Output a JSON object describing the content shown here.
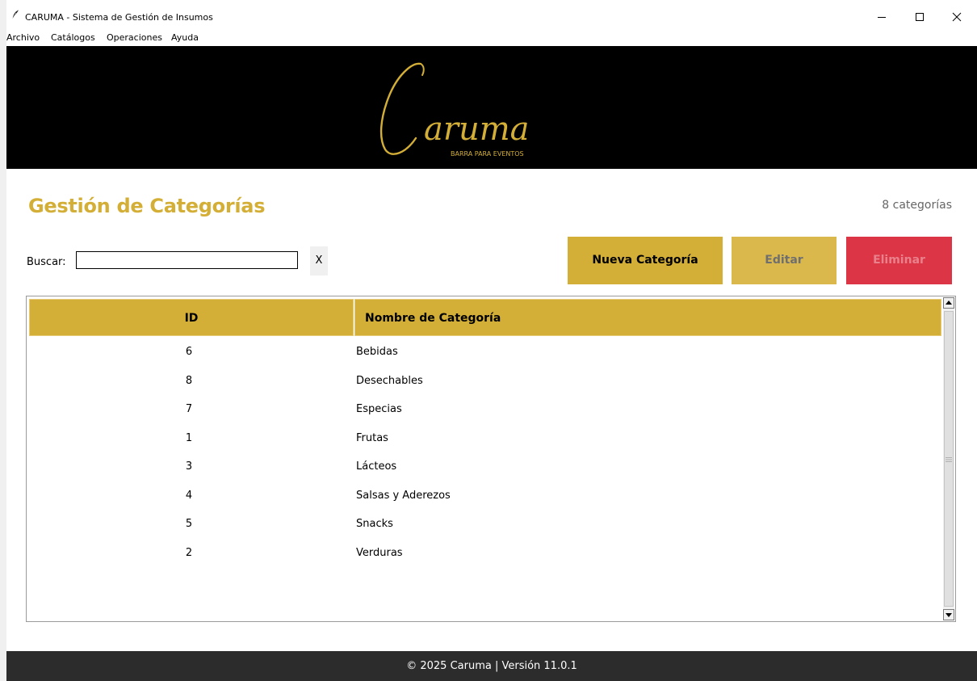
{
  "window": {
    "title": "CARUMA - Sistema de Gestión de Insumos"
  },
  "menu": {
    "items": [
      "Archivo",
      "Catálogos",
      "Operaciones",
      "Ayuda"
    ]
  },
  "banner": {
    "logo_text": "aruma",
    "logo_initial": "C",
    "tagline": "BARRA PARA EVENTOS",
    "background_color": "#000000",
    "logo_color": "#d4af37"
  },
  "page": {
    "title": "Gestión de Categorías",
    "count_label": "8 categorías"
  },
  "search": {
    "label": "Buscar:",
    "value": "",
    "clear_label": "X"
  },
  "actions": {
    "new_label": "Nueva Categoría",
    "edit_label": "Editar",
    "delete_label": "Eliminar"
  },
  "table": {
    "columns": [
      "ID",
      "Nombre de Categoría"
    ],
    "rows": [
      {
        "id": "6",
        "name": "Bebidas"
      },
      {
        "id": "8",
        "name": "Desechables"
      },
      {
        "id": "7",
        "name": "Especias"
      },
      {
        "id": "1",
        "name": "Frutas"
      },
      {
        "id": "3",
        "name": "Lácteos"
      },
      {
        "id": "4",
        "name": "Salsas y Aderezos"
      },
      {
        "id": "5",
        "name": "Snacks"
      },
      {
        "id": "2",
        "name": "Verduras"
      }
    ]
  },
  "footer": {
    "text": "© 2025 Caruma | Versión 11.0.1"
  },
  "colors": {
    "accent": "#d4af37",
    "danger": "#dc3545",
    "footer_bg": "#2c2c2c"
  },
  "icons": {
    "app": "feather-icon",
    "minimize": "minimize-icon",
    "maximize": "maximize-icon",
    "close": "close-icon"
  }
}
